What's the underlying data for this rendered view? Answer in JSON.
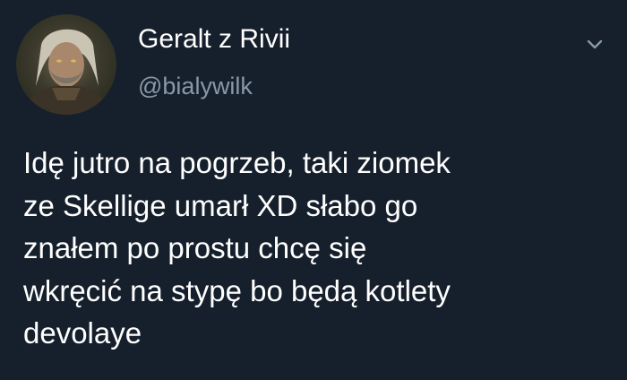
{
  "tweet": {
    "author": {
      "display_name": "Geralt z Rivii",
      "handle": "@bialywilk",
      "avatar_icon": "avatar-geralt"
    },
    "menu_icon": "chevron-down-icon",
    "text_lines": [
      "Idę jutro na pogrzeb, taki ziomek",
      "ze Skellige umarł XD słabo go",
      "znałem po prostu chcę się",
      "wkręcić na stypę bo będą kotlety",
      "devolaye"
    ]
  },
  "colors": {
    "background": "#16202c",
    "primary_text": "#ffffff",
    "secondary_text": "#8899a6"
  }
}
